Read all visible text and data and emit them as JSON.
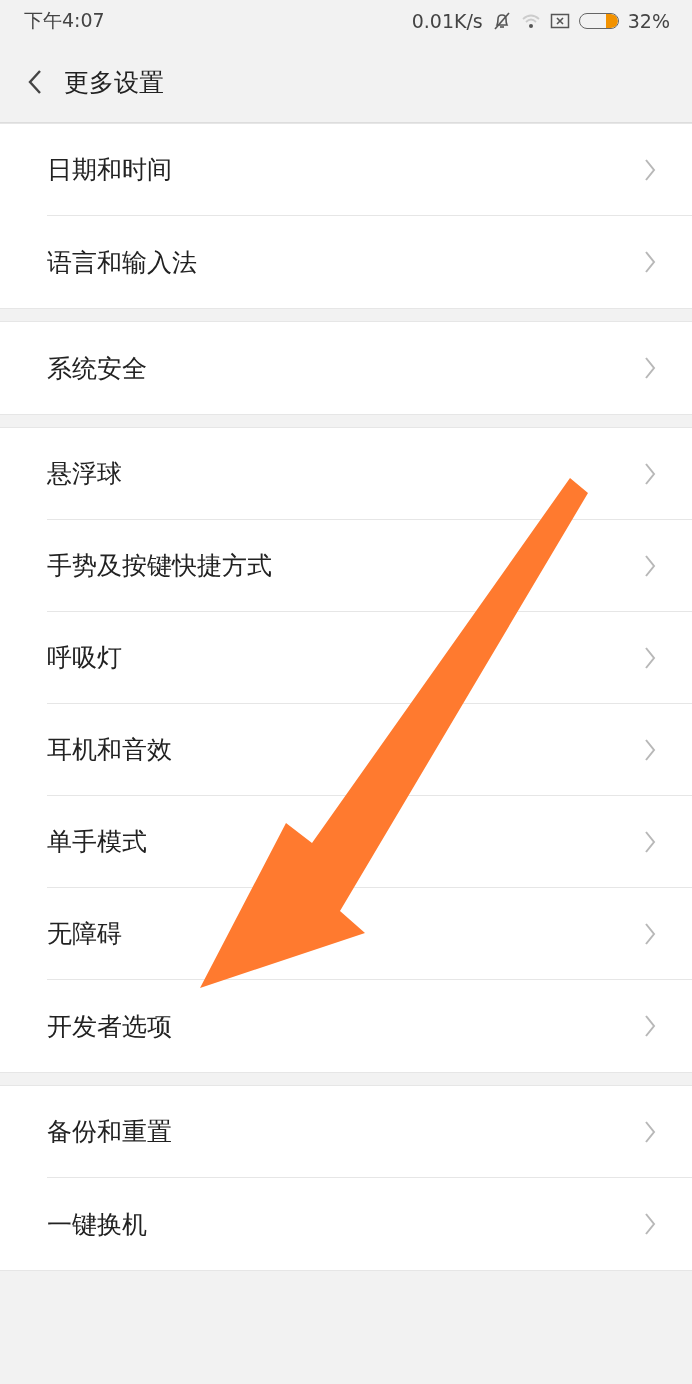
{
  "status_bar": {
    "time": "下午4:07",
    "net_speed": "0.01K/s",
    "battery": {
      "level": 0.32,
      "reading": "32%"
    }
  },
  "header": {
    "title": "更多设置"
  },
  "groups": [
    {
      "items": [
        {
          "label": "日期和时间"
        },
        {
          "label": "语言和输入法"
        }
      ]
    },
    {
      "items": [
        {
          "label": "系统安全"
        }
      ]
    },
    {
      "items": [
        {
          "label": "悬浮球"
        },
        {
          "label": "手势及按键快捷方式"
        },
        {
          "label": "呼吸灯"
        },
        {
          "label": "耳机和音效"
        },
        {
          "label": "单手模式"
        },
        {
          "label": "无障碍"
        },
        {
          "label": "开发者选项"
        }
      ]
    },
    {
      "items": [
        {
          "label": "备份和重置"
        },
        {
          "label": "一键换机"
        }
      ]
    }
  ],
  "annotations": [
    {
      "kind": "arrow"
    }
  ]
}
